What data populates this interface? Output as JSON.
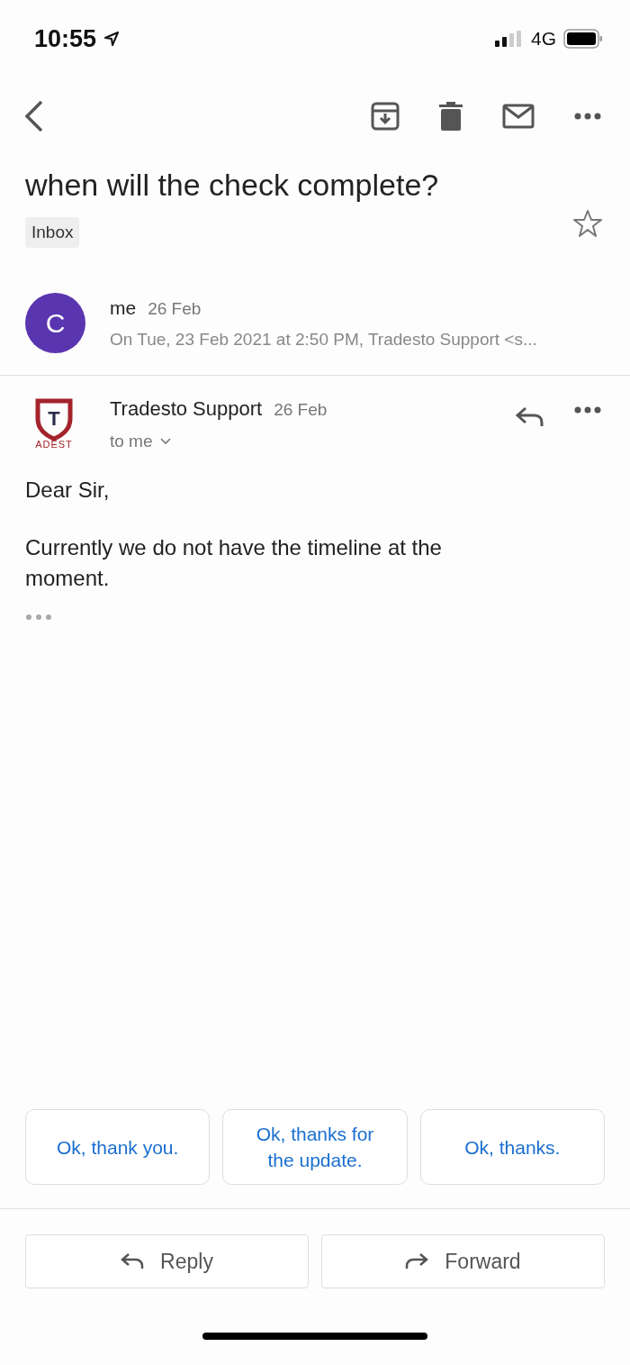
{
  "status_bar": {
    "time": "10:55",
    "network": "4G"
  },
  "subject": "when will the check complete?",
  "label": "Inbox",
  "starred": false,
  "messages": [
    {
      "avatar_letter": "C",
      "sender": "me",
      "date": "26 Feb",
      "snippet": "On Tue, 23 Feb 2021 at 2:50 PM, Tradesto Support <s...",
      "expanded": false
    },
    {
      "logo_letter": "T",
      "logo_caption": "ADEST",
      "sender": "Tradesto Support",
      "date": "26 Feb",
      "recipient": "to me",
      "expanded": true,
      "body": [
        "Dear Sir,",
        "Currently we do not have the timeline at the moment."
      ]
    }
  ],
  "smart_replies": [
    "Ok, thank you.",
    "Ok, thanks for the update.",
    "Ok, thanks."
  ],
  "actions": [
    {
      "label": "Reply",
      "kind": "reply"
    },
    {
      "label": "Forward",
      "kind": "forward"
    }
  ]
}
